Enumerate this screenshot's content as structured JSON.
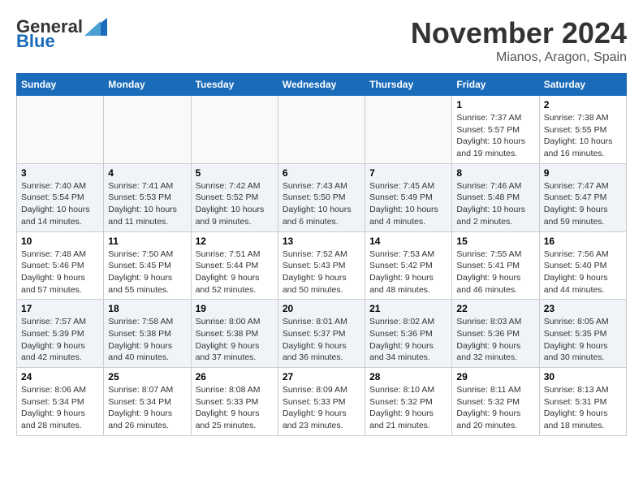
{
  "header": {
    "logo": {
      "general": "General",
      "blue": "Blue"
    },
    "title": "November 2024",
    "location": "Mianos, Aragon, Spain"
  },
  "weekdays": [
    "Sunday",
    "Monday",
    "Tuesday",
    "Wednesday",
    "Thursday",
    "Friday",
    "Saturday"
  ],
  "weeks": [
    [
      {
        "day": "",
        "info": ""
      },
      {
        "day": "",
        "info": ""
      },
      {
        "day": "",
        "info": ""
      },
      {
        "day": "",
        "info": ""
      },
      {
        "day": "",
        "info": ""
      },
      {
        "day": "1",
        "info": "Sunrise: 7:37 AM\nSunset: 5:57 PM\nDaylight: 10 hours and 19 minutes."
      },
      {
        "day": "2",
        "info": "Sunrise: 7:38 AM\nSunset: 5:55 PM\nDaylight: 10 hours and 16 minutes."
      }
    ],
    [
      {
        "day": "3",
        "info": "Sunrise: 7:40 AM\nSunset: 5:54 PM\nDaylight: 10 hours and 14 minutes."
      },
      {
        "day": "4",
        "info": "Sunrise: 7:41 AM\nSunset: 5:53 PM\nDaylight: 10 hours and 11 minutes."
      },
      {
        "day": "5",
        "info": "Sunrise: 7:42 AM\nSunset: 5:52 PM\nDaylight: 10 hours and 9 minutes."
      },
      {
        "day": "6",
        "info": "Sunrise: 7:43 AM\nSunset: 5:50 PM\nDaylight: 10 hours and 6 minutes."
      },
      {
        "day": "7",
        "info": "Sunrise: 7:45 AM\nSunset: 5:49 PM\nDaylight: 10 hours and 4 minutes."
      },
      {
        "day": "8",
        "info": "Sunrise: 7:46 AM\nSunset: 5:48 PM\nDaylight: 10 hours and 2 minutes."
      },
      {
        "day": "9",
        "info": "Sunrise: 7:47 AM\nSunset: 5:47 PM\nDaylight: 9 hours and 59 minutes."
      }
    ],
    [
      {
        "day": "10",
        "info": "Sunrise: 7:48 AM\nSunset: 5:46 PM\nDaylight: 9 hours and 57 minutes."
      },
      {
        "day": "11",
        "info": "Sunrise: 7:50 AM\nSunset: 5:45 PM\nDaylight: 9 hours and 55 minutes."
      },
      {
        "day": "12",
        "info": "Sunrise: 7:51 AM\nSunset: 5:44 PM\nDaylight: 9 hours and 52 minutes."
      },
      {
        "day": "13",
        "info": "Sunrise: 7:52 AM\nSunset: 5:43 PM\nDaylight: 9 hours and 50 minutes."
      },
      {
        "day": "14",
        "info": "Sunrise: 7:53 AM\nSunset: 5:42 PM\nDaylight: 9 hours and 48 minutes."
      },
      {
        "day": "15",
        "info": "Sunrise: 7:55 AM\nSunset: 5:41 PM\nDaylight: 9 hours and 46 minutes."
      },
      {
        "day": "16",
        "info": "Sunrise: 7:56 AM\nSunset: 5:40 PM\nDaylight: 9 hours and 44 minutes."
      }
    ],
    [
      {
        "day": "17",
        "info": "Sunrise: 7:57 AM\nSunset: 5:39 PM\nDaylight: 9 hours and 42 minutes."
      },
      {
        "day": "18",
        "info": "Sunrise: 7:58 AM\nSunset: 5:38 PM\nDaylight: 9 hours and 40 minutes."
      },
      {
        "day": "19",
        "info": "Sunrise: 8:00 AM\nSunset: 5:38 PM\nDaylight: 9 hours and 37 minutes."
      },
      {
        "day": "20",
        "info": "Sunrise: 8:01 AM\nSunset: 5:37 PM\nDaylight: 9 hours and 36 minutes."
      },
      {
        "day": "21",
        "info": "Sunrise: 8:02 AM\nSunset: 5:36 PM\nDaylight: 9 hours and 34 minutes."
      },
      {
        "day": "22",
        "info": "Sunrise: 8:03 AM\nSunset: 5:36 PM\nDaylight: 9 hours and 32 minutes."
      },
      {
        "day": "23",
        "info": "Sunrise: 8:05 AM\nSunset: 5:35 PM\nDaylight: 9 hours and 30 minutes."
      }
    ],
    [
      {
        "day": "24",
        "info": "Sunrise: 8:06 AM\nSunset: 5:34 PM\nDaylight: 9 hours and 28 minutes."
      },
      {
        "day": "25",
        "info": "Sunrise: 8:07 AM\nSunset: 5:34 PM\nDaylight: 9 hours and 26 minutes."
      },
      {
        "day": "26",
        "info": "Sunrise: 8:08 AM\nSunset: 5:33 PM\nDaylight: 9 hours and 25 minutes."
      },
      {
        "day": "27",
        "info": "Sunrise: 8:09 AM\nSunset: 5:33 PM\nDaylight: 9 hours and 23 minutes."
      },
      {
        "day": "28",
        "info": "Sunrise: 8:10 AM\nSunset: 5:32 PM\nDaylight: 9 hours and 21 minutes."
      },
      {
        "day": "29",
        "info": "Sunrise: 8:11 AM\nSunset: 5:32 PM\nDaylight: 9 hours and 20 minutes."
      },
      {
        "day": "30",
        "info": "Sunrise: 8:13 AM\nSunset: 5:31 PM\nDaylight: 9 hours and 18 minutes."
      }
    ]
  ]
}
